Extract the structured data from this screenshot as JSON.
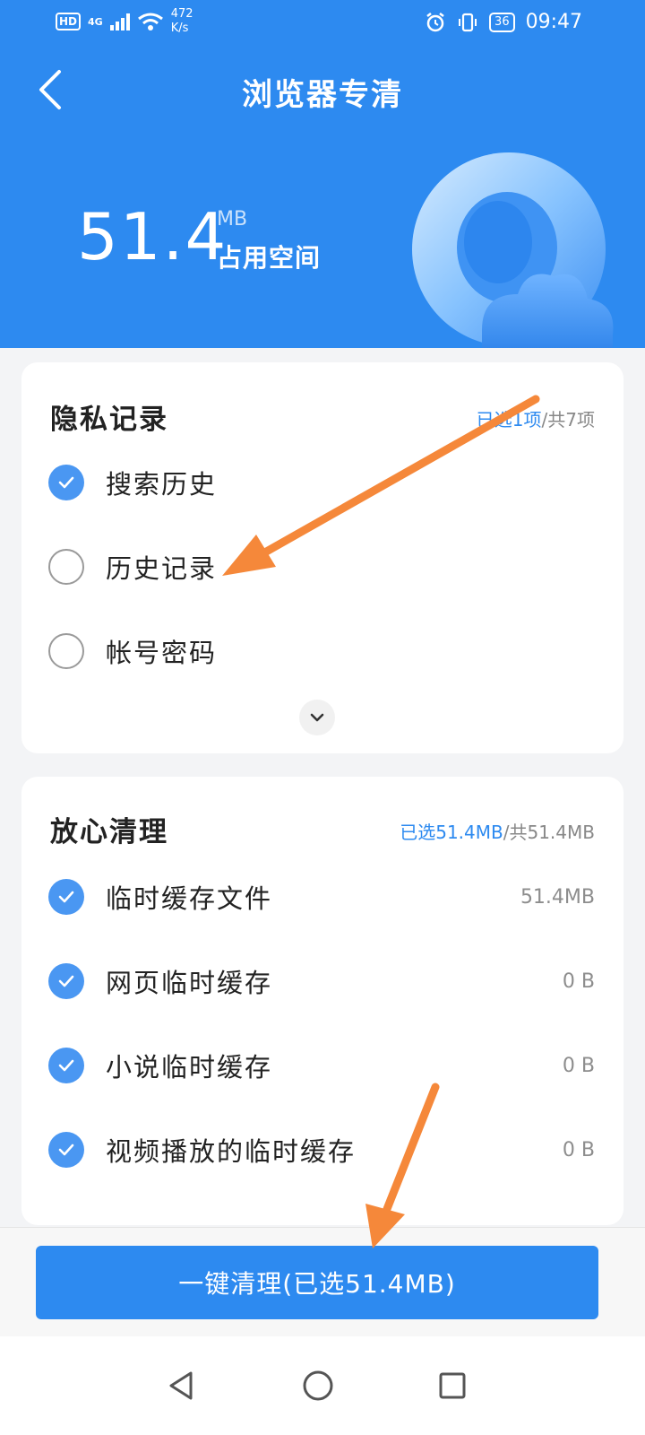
{
  "status_bar": {
    "hd": "HD",
    "network": "4G",
    "speed_value": "472",
    "speed_unit": "K/s",
    "battery": "36",
    "time": "09:47"
  },
  "header": {
    "title": "浏览器专清",
    "size_value": "51.4",
    "size_unit": "MB",
    "size_label": "占用空间"
  },
  "privacy": {
    "title": "隐私记录",
    "summary_selected": "已选1项",
    "summary_total": "/共7项",
    "items": [
      {
        "label": "搜索历史",
        "checked": true
      },
      {
        "label": "历史记录",
        "checked": false
      },
      {
        "label": "帐号密码",
        "checked": false
      }
    ]
  },
  "safe_clean": {
    "title": "放心清理",
    "summary_selected": "已选51.4MB",
    "summary_total": "/共51.4MB",
    "items": [
      {
        "label": "临时缓存文件",
        "value": "51.4MB",
        "checked": true
      },
      {
        "label": "网页临时缓存",
        "value": "0 B",
        "checked": true
      },
      {
        "label": "小说临时缓存",
        "value": "0 B",
        "checked": true
      },
      {
        "label": "视频播放的临时缓存",
        "value": "0 B",
        "checked": true
      }
    ]
  },
  "bottom": {
    "clean_button": "一键清理(已选51.4MB)"
  },
  "colors": {
    "primary": "#2d8af0",
    "check": "#4a97f2",
    "annotation_arrow": "#f5883a"
  }
}
